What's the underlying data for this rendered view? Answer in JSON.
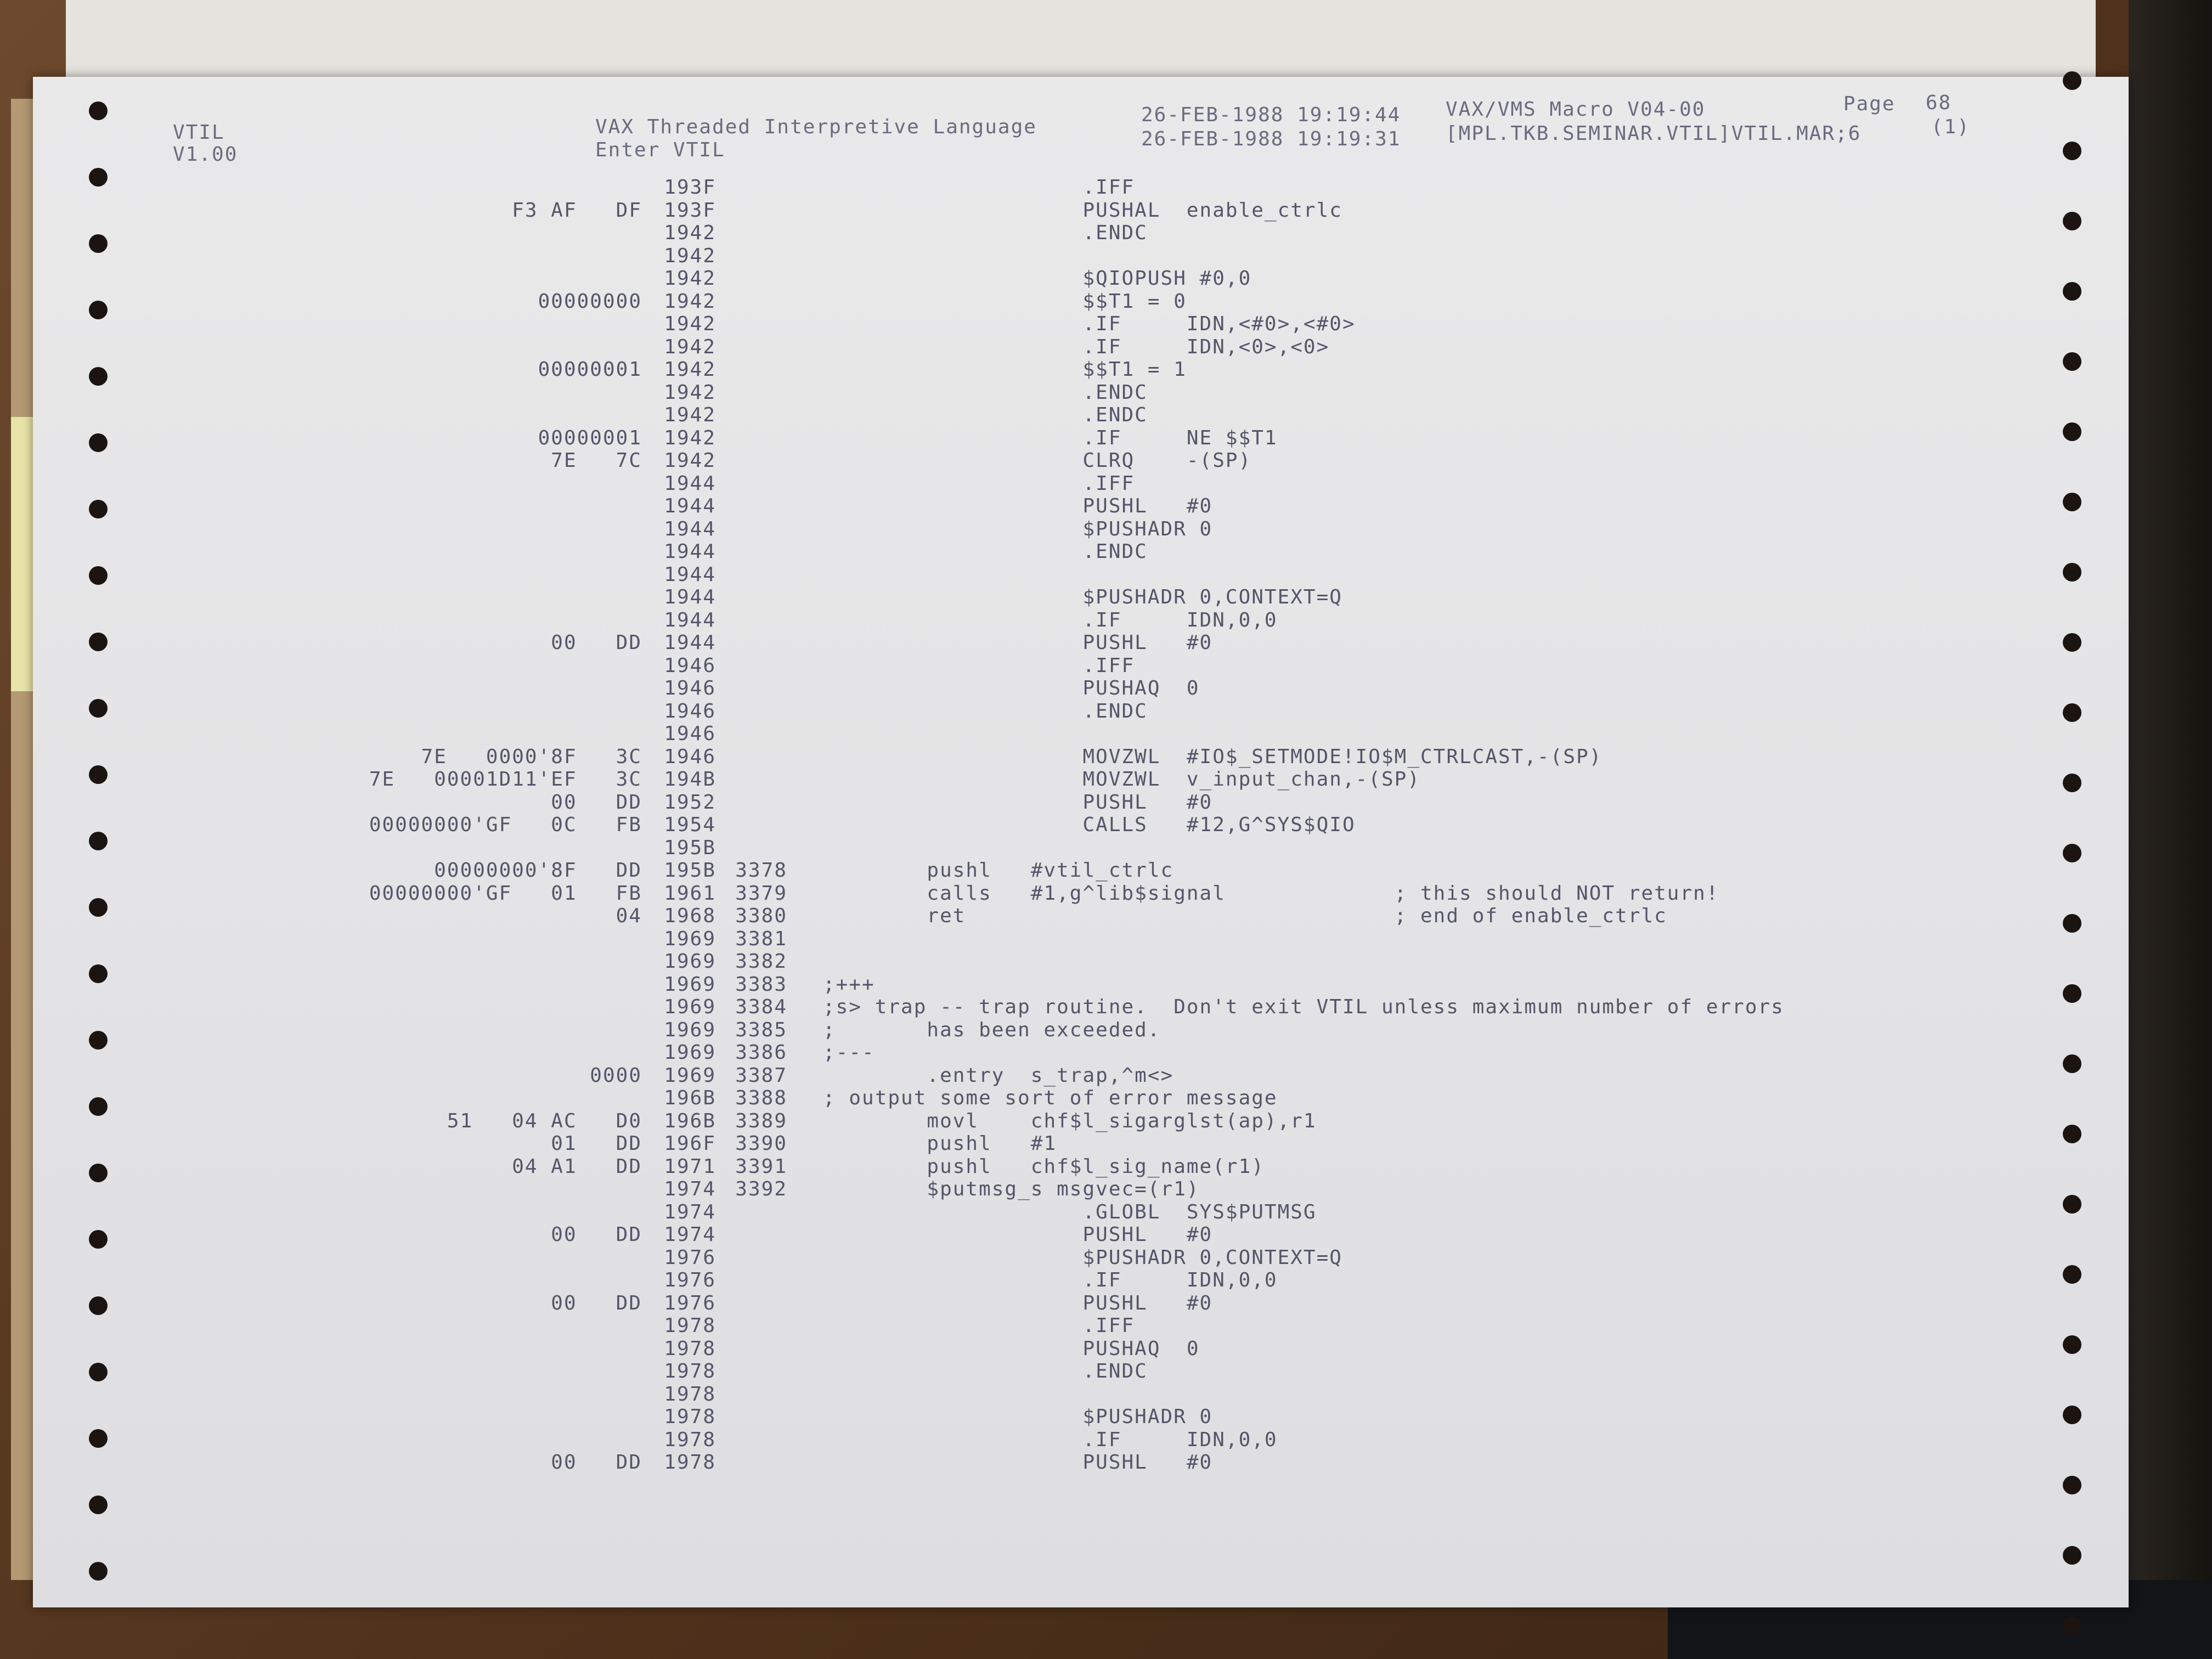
{
  "header": {
    "module": "VTIL",
    "version": "V1.00",
    "title": "VAX Threaded Interpretive Language",
    "subtitle": "Enter VTIL",
    "line1_datetime": "26-FEB-1988 19:19:44",
    "assembler": "VAX/VMS Macro V04-00",
    "page_label": "Page",
    "page_number": "68",
    "line2_datetime": "26-FEB-1988 19:19:31",
    "source_file": "[MPL.TKB.SEMINAR.VTIL]VTIL.MAR;6",
    "page_sub": "(1)"
  },
  "listing": [
    {
      "obj": "",
      "loc": "193F",
      "line": "",
      "src": "                    .IFF"
    },
    {
      "obj": "F3 AF   DF",
      "loc": "193F",
      "line": "",
      "src": "                    PUSHAL  enable_ctrlc"
    },
    {
      "obj": "",
      "loc": "1942",
      "line": "",
      "src": "                    .ENDC"
    },
    {
      "obj": "",
      "loc": "1942",
      "line": "",
      "src": ""
    },
    {
      "obj": "",
      "loc": "1942",
      "line": "",
      "src": "                    $QIOPUSH #0,0"
    },
    {
      "obj": "00000000",
      "loc": "1942",
      "line": "",
      "src": "                    $$T1 = 0"
    },
    {
      "obj": "",
      "loc": "1942",
      "line": "",
      "src": "                    .IF     IDN,<#0>,<#0>"
    },
    {
      "obj": "",
      "loc": "1942",
      "line": "",
      "src": "                    .IF     IDN,<0>,<0>"
    },
    {
      "obj": "00000001",
      "loc": "1942",
      "line": "",
      "src": "                    $$T1 = 1"
    },
    {
      "obj": "",
      "loc": "1942",
      "line": "",
      "src": "                    .ENDC"
    },
    {
      "obj": "",
      "loc": "1942",
      "line": "",
      "src": "                    .ENDC"
    },
    {
      "obj": "00000001",
      "loc": "1942",
      "line": "",
      "src": "                    .IF     NE $$T1"
    },
    {
      "obj": "7E   7C",
      "loc": "1942",
      "line": "",
      "src": "                    CLRQ    -(SP)"
    },
    {
      "obj": "",
      "loc": "1944",
      "line": "",
      "src": "                    .IFF"
    },
    {
      "obj": "",
      "loc": "1944",
      "line": "",
      "src": "                    PUSHL   #0"
    },
    {
      "obj": "",
      "loc": "1944",
      "line": "",
      "src": "                    $PUSHADR 0"
    },
    {
      "obj": "",
      "loc": "1944",
      "line": "",
      "src": "                    .ENDC"
    },
    {
      "obj": "",
      "loc": "1944",
      "line": "",
      "src": ""
    },
    {
      "obj": "",
      "loc": "1944",
      "line": "",
      "src": "                    $PUSHADR 0,CONTEXT=Q"
    },
    {
      "obj": "",
      "loc": "1944",
      "line": "",
      "src": "                    .IF     IDN,0,0"
    },
    {
      "obj": "00   DD",
      "loc": "1944",
      "line": "",
      "src": "                    PUSHL   #0"
    },
    {
      "obj": "",
      "loc": "1946",
      "line": "",
      "src": "                    .IFF"
    },
    {
      "obj": "",
      "loc": "1946",
      "line": "",
      "src": "                    PUSHAQ  0"
    },
    {
      "obj": "",
      "loc": "1946",
      "line": "",
      "src": "                    .ENDC"
    },
    {
      "obj": "",
      "loc": "1946",
      "line": "",
      "src": ""
    },
    {
      "obj": "7E   0000'8F   3C",
      "loc": "1946",
      "line": "",
      "src": "                    MOVZWL  #IO$_SETMODE!IO$M_CTRLCAST,-(SP)"
    },
    {
      "obj": "7E   00001D11'EF   3C",
      "loc": "194B",
      "line": "",
      "src": "                    MOVZWL  v_input_chan,-(SP)"
    },
    {
      "obj": "00   DD",
      "loc": "1952",
      "line": "",
      "src": "                    PUSHL   #0"
    },
    {
      "obj": "00000000'GF   0C   FB",
      "loc": "1954",
      "line": "",
      "src": "                    CALLS   #12,G^SYS$QIO"
    },
    {
      "obj": "",
      "loc": "195B",
      "line": "",
      "src": ""
    },
    {
      "obj": "00000000'8F   DD",
      "loc": "195B",
      "line": "3378",
      "src": "        pushl   #vtil_ctrlc"
    },
    {
      "obj": "00000000'GF   01   FB",
      "loc": "1961",
      "line": "3379",
      "src": "        calls   #1,g^lib$signal             ; this should NOT return!"
    },
    {
      "obj": "04",
      "loc": "1968",
      "line": "3380",
      "src": "        ret                                 ; end of enable_ctrlc"
    },
    {
      "obj": "",
      "loc": "1969",
      "line": "3381",
      "src": ""
    },
    {
      "obj": "",
      "loc": "1969",
      "line": "3382",
      "src": ""
    },
    {
      "obj": "",
      "loc": "1969",
      "line": "3383",
      "src": ";+++"
    },
    {
      "obj": "",
      "loc": "1969",
      "line": "3384",
      "src": ";s> trap -- trap routine.  Don't exit VTIL unless maximum number of errors"
    },
    {
      "obj": "",
      "loc": "1969",
      "line": "3385",
      "src": ";       has been exceeded."
    },
    {
      "obj": "",
      "loc": "1969",
      "line": "3386",
      "src": ";---"
    },
    {
      "obj": "0000",
      "loc": "1969",
      "line": "3387",
      "src": "        .entry  s_trap,^m<>"
    },
    {
      "obj": "",
      "loc": "196B",
      "line": "3388",
      "src": "; output some sort of error message"
    },
    {
      "obj": "51   04 AC   D0",
      "loc": "196B",
      "line": "3389",
      "src": "        movl    chf$l_sigarglst(ap),r1"
    },
    {
      "obj": "01   DD",
      "loc": "196F",
      "line": "3390",
      "src": "        pushl   #1"
    },
    {
      "obj": "04 A1   DD",
      "loc": "1971",
      "line": "3391",
      "src": "        pushl   chf$l_sig_name(r1)"
    },
    {
      "obj": "",
      "loc": "1974",
      "line": "3392",
      "src": "        $putmsg_s msgvec=(r1)"
    },
    {
      "obj": "",
      "loc": "1974",
      "line": "",
      "src": "                    .GLOBL  SYS$PUTMSG"
    },
    {
      "obj": "00   DD",
      "loc": "1974",
      "line": "",
      "src": "                    PUSHL   #0"
    },
    {
      "obj": "",
      "loc": "1976",
      "line": "",
      "src": "                    $PUSHADR 0,CONTEXT=Q"
    },
    {
      "obj": "",
      "loc": "1976",
      "line": "",
      "src": "                    .IF     IDN,0,0"
    },
    {
      "obj": "00   DD",
      "loc": "1976",
      "line": "",
      "src": "                    PUSHL   #0"
    },
    {
      "obj": "",
      "loc": "1978",
      "line": "",
      "src": "                    .IFF"
    },
    {
      "obj": "",
      "loc": "1978",
      "line": "",
      "src": "                    PUSHAQ  0"
    },
    {
      "obj": "",
      "loc": "1978",
      "line": "",
      "src": "                    .ENDC"
    },
    {
      "obj": "",
      "loc": "1978",
      "line": "",
      "src": ""
    },
    {
      "obj": "",
      "loc": "1978",
      "line": "",
      "src": "                    $PUSHADR 0"
    },
    {
      "obj": "",
      "loc": "1978",
      "line": "",
      "src": "                    .IF     IDN,0,0"
    },
    {
      "obj": "00   DD",
      "loc": "1978",
      "line": "",
      "src": "                    PUSHL   #0"
    }
  ]
}
